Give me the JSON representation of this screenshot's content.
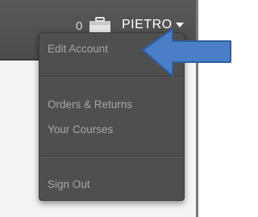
{
  "header": {
    "cart_count": "0",
    "user_name": "PIETRO"
  },
  "dropdown": {
    "items": [
      {
        "label": "Edit Account"
      },
      {
        "label": "Orders & Returns"
      },
      {
        "label": "Your Courses"
      },
      {
        "label": "Sign Out"
      }
    ]
  },
  "annotation": {
    "arrow_color": "#4a7fc7",
    "arrow_outline": "#2f5e9e"
  },
  "icons": [
    "shopping-bag-icon",
    "chevron-down-icon",
    "pointer-arrow-icon"
  ]
}
